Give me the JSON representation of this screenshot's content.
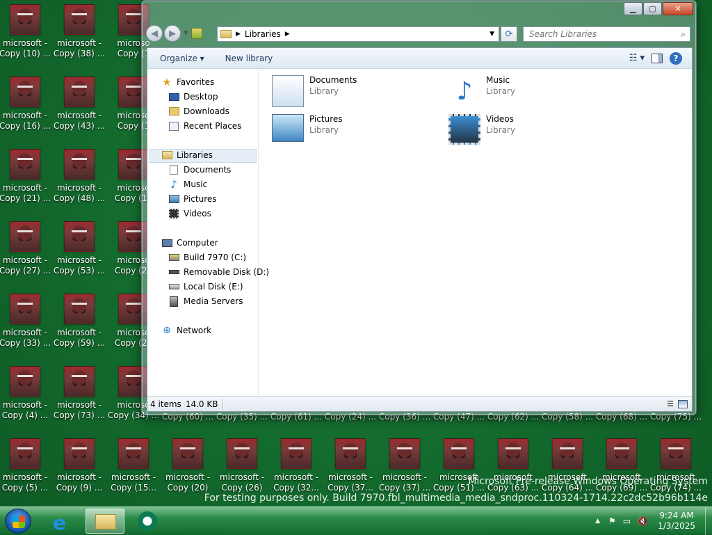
{
  "desktop": {
    "icons": [
      {
        "l1": "microsoft -",
        "l2": "Copy (10) ..."
      },
      {
        "l1": "microsoft -",
        "l2": "Copy (38) ..."
      },
      {
        "l1": "microso",
        "l2": "Copy (1"
      },
      {
        "l1": "microsoft -",
        "l2": "Copy (16) ..."
      },
      {
        "l1": "microsoft -",
        "l2": "Copy (43) ..."
      },
      {
        "l1": "microso",
        "l2": "Copy (1"
      },
      {
        "l1": "microsoft -",
        "l2": "Copy (21) ..."
      },
      {
        "l1": "microsoft -",
        "l2": "Copy (48) ..."
      },
      {
        "l1": "microso",
        "l2": "Copy (17"
      },
      {
        "l1": "microsoft -",
        "l2": "Copy (27) ..."
      },
      {
        "l1": "microsoft -",
        "l2": "Copy (53) ..."
      },
      {
        "l1": "microso",
        "l2": "Copy (22"
      },
      {
        "l1": "microsoft -",
        "l2": "Copy (33) ..."
      },
      {
        "l1": "microsoft -",
        "l2": "Copy (59) ..."
      },
      {
        "l1": "microso",
        "l2": "Copy (28"
      },
      {
        "l1": "microsoft -",
        "l2": "Copy (4) ..."
      },
      {
        "l1": "microsoft -",
        "l2": "Copy (73) ..."
      },
      {
        "l1": "microso",
        "l2": "Copy (34) ..."
      }
    ],
    "row6_labels": [
      "Copy (60) ...",
      "Copy (35) ...",
      "Copy (61) ...",
      "Copy (24) ...",
      "Copy (36) ...",
      "Copy (47) ...",
      "Copy (62) ...",
      "Copy (58) ...",
      "Copy (68) ...",
      "Copy (75) ..."
    ],
    "bottom_icons": [
      {
        "l1": "microsoft -",
        "l2": "Copy (5) ..."
      },
      {
        "l1": "microsoft -",
        "l2": "Copy (9) ..."
      },
      {
        "l1": "microsoft -",
        "l2": "Copy (15..."
      },
      {
        "l1": "microsoft -",
        "l2": "Copy (20)"
      },
      {
        "l1": "microsoft -",
        "l2": "Copy (26)"
      },
      {
        "l1": "microsoft -",
        "l2": "Copy (32..."
      },
      {
        "l1": "microsoft -",
        "l2": "Copy (37..."
      },
      {
        "l1": "microsoft -",
        "l2": "Copy (37) ..."
      },
      {
        "l1": "microsoft",
        "l2": "Copy (51) ..."
      },
      {
        "l1": "microsoft",
        "l2": "Copy (63) ..."
      },
      {
        "l1": "microsoft",
        "l2": "Copy (64) ..."
      },
      {
        "l1": "microsoft",
        "l2": "Copy (69) ..."
      },
      {
        "l1": "microsoft",
        "l2": "Copy (74) ..."
      }
    ]
  },
  "window": {
    "breadcrumb_root": "Libraries",
    "search_placeholder": "Search Libraries",
    "toolbar": {
      "organize": "Organize ▾",
      "new_library": "New library"
    },
    "nav": {
      "favorites": "Favorites",
      "desktop": "Desktop",
      "downloads": "Downloads",
      "recent": "Recent Places",
      "libraries": "Libraries",
      "documents": "Documents",
      "music": "Music",
      "pictures": "Pictures",
      "videos": "Videos",
      "computer": "Computer",
      "drive_c": "Build 7970 (C:)",
      "drive_d": "Removable Disk (D:)",
      "drive_e": "Local Disk (E:)",
      "media_servers": "Media Servers",
      "network": "Network"
    },
    "libraries": [
      {
        "name": "Documents",
        "sub": "Library"
      },
      {
        "name": "Music",
        "sub": "Library"
      },
      {
        "name": "Pictures",
        "sub": "Library"
      },
      {
        "name": "Videos",
        "sub": "Library"
      }
    ],
    "status": {
      "items": "4 items",
      "size": "14.0 KB"
    }
  },
  "watermark": {
    "line1": "Microsoft Pre-release Windows Operating System",
    "line2": "For testing purposes only. Build 7970.fbl_multimedia_media_sndproc.110324-1714.22c2dc52b96b114e"
  },
  "taskbar": {
    "time": "9:24 AM",
    "date": "1/3/2025"
  }
}
